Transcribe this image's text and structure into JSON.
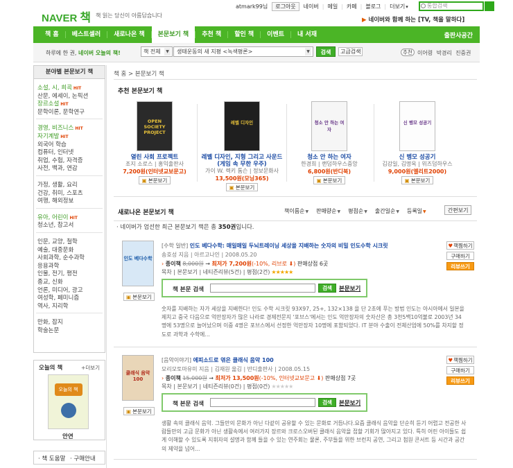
{
  "header": {
    "logo_naver": "NAVER",
    "logo_book": "책",
    "slogan": "책 읽는 당신이 아름답습니다",
    "user": "atmark99님",
    "logout": "로그아웃",
    "nav": [
      "네이버",
      "메일",
      "카페",
      "블로그",
      "더보기"
    ],
    "more_arrow": "▾",
    "search_placeholder": "통합검색",
    "promo": "네이버와 함께 하는 [TV, 책을 말하다]",
    "promo_arrow": "▶"
  },
  "gnav": {
    "items": [
      "책 홈",
      "베스트셀러",
      "새로나온 책",
      "본문보기 책",
      "추천 책",
      "할인 책",
      "이벤트",
      "내 서재"
    ],
    "active_index": 3,
    "right": "출판사공간"
  },
  "subbar": {
    "prefix": "하루에 한 권, ",
    "highlight": "네이버 오늘의 책!",
    "category_value": "책 전체",
    "keyword_value": "생태운동의 새 지평 <녹색평론>",
    "search_btn": "검색",
    "advanced_btn": "고급검색",
    "rec_badge": "추천",
    "rec_names": [
      "이어령",
      "박경리",
      "진중권"
    ]
  },
  "sidebar": {
    "title": "분야별 본문보기 책",
    "groups": [
      [
        {
          "t": "소설, 시, 희곡",
          "g": true,
          "hit": true
        },
        {
          "t": "산문, 에세이, 논픽션"
        },
        {
          "t": "장르소설",
          "g": true,
          "hit": true
        },
        {
          "t": "문학이론, 문학연구"
        }
      ],
      [
        {
          "t": "경영, 비즈니스",
          "g": true,
          "hit": true
        },
        {
          "t": "자기계발",
          "g": true,
          "hit": true
        },
        {
          "t": "외국어 학습"
        },
        {
          "t": "컴퓨터, 인터넷"
        },
        {
          "t": "취업, 수험, 자격증"
        },
        {
          "t": "사전, 백과, 연감"
        }
      ],
      [
        {
          "t": "가정, 생활, 요리"
        },
        {
          "t": "건강, 취미, 스포츠"
        },
        {
          "t": "여행, 해외정보"
        }
      ],
      [
        {
          "t": "유아, 어린이",
          "g": true,
          "hit": true
        },
        {
          "t": "청소년, 참고서"
        }
      ],
      [
        {
          "t": "인문, 교양, 철학"
        },
        {
          "t": "예술, 대중문화"
        },
        {
          "t": "사회과학, 순수과학"
        },
        {
          "t": "응용과학"
        },
        {
          "t": "인물, 전기, 평전"
        },
        {
          "t": "종교, 신화"
        },
        {
          "t": "언론, 미디어, 광고"
        },
        {
          "t": "여성학, 페미니즘"
        },
        {
          "t": "역사, 지리학"
        }
      ],
      [
        {
          "t": "만화, 잡지"
        },
        {
          "t": "학술논문"
        }
      ]
    ],
    "hit_label": "HIT",
    "today_title": "오늘의 책",
    "today_more": "+더보기",
    "today_book": "안연",
    "today_cover_text": "오늘의 책",
    "help1": "책 도움말",
    "help2": "구매안내"
  },
  "main": {
    "breadcrumb": "책 홈 > 본문보기 책",
    "rec_title": "추천 본문보기 책",
    "rec_books": [
      {
        "title": "열린 사회 프로젝트",
        "author": "조지 소로스 | 홍익출판사",
        "price": "7,200원(인터넷교보문고)",
        "btn": "본문보기",
        "cover": "#2a2a2a",
        "cover_text": "OPEN SOCIETY PROJECT"
      },
      {
        "title": "레벨 디자인, 지형 그리고 사운드 (게임 속 무한 우주)",
        "author": "가이 W. 렉키 톰슨 | 정보문화사",
        "price": "13,500원(모닝365)",
        "btn": "본문보기",
        "cover": "#1f1f1f",
        "cover_text": "레벨 디자인"
      },
      {
        "title": "청소 안 하는 여자",
        "author": "한경희 | 랜덤하우스중앙",
        "price": "6,800원(반디북)",
        "btn": "본문보기",
        "cover": "#f6f6f6",
        "cover_text": "청소 안 하는 여자"
      },
      {
        "title": "신 벵모 성공기",
        "author": "김강일, 김명옥 | 위즈덤하우스",
        "price": "9,000원(엘리트2000)",
        "btn": "본문보기",
        "cover": "#fdfdfd",
        "cover_text": "신 벵모 성공기"
      }
    ],
    "new_title": "새로나온 본문보기 책",
    "sorts": [
      "책이름순",
      "판매량순",
      "평점순",
      "출간일순",
      "등록일"
    ],
    "simple_btn": "간편보기",
    "count_text": "네이버가 엄선한 최근 본문보기 책은 총 ",
    "count_num": "350권",
    "count_suffix": "입니다.",
    "items": [
      {
        "category": "[수학 일반]",
        "title": "인도 베다수학: 매일매일 두뇌트레이닝 세상을 지배하는 숫자의 비밀 인도수학 시크릿",
        "meta": "송호성 지음 | 아르고나인 | 2008.05.20",
        "price_label": "종이책",
        "old_price": "8,000원",
        "new_price": "최저가 7,200원",
        "discount": "(-10%, 리브로",
        "stores": "판매상점 6곳",
        "links": "목차 | 본문보기 | 네티즌리뷰(5건) | 평점(2건)",
        "stars": 5,
        "cover_text": "인도 베다수학",
        "actions": [
          "책찜하기",
          "구매하기",
          "리뷰쓰기"
        ],
        "search_label": "책 본문 검색",
        "search_btn": "검색",
        "preview": "본문보기",
        "btn": "본문보기",
        "desc": "숫자를 지배하는 자가 세상을 지배한다! 인도 수학 시크릿 93X97, 25+, 132×138 을 단 2초에 푸는 방법 인도는 아시아에서 일본을 제치고 중국 다음으로 억만장자가 많은 나라로 경제전문지 '포브스'에서는 인도 억만장자의 숫자산은 총 3천5백10억불로 2003년 34명에 53명으로 늘어났으며 이중 4명은 포브스에서 선정한 억만장자 10명에 포함되었다. IT 분야 수출이 전체산업에 50%를 차지할 정도로 과학과 수학에..."
      },
      {
        "category": "[음악이야기]",
        "title": "에피소드로 엮은 클래식 음악 100",
        "meta": "모리모토마유미 지음 | 김재원 옮김 | 반디출판사 | 2008.05.15",
        "price_label": "종이책",
        "old_price": "15,000원",
        "new_price": "최저가 13,500원",
        "discount": "(-10%, 인터넷교보문고",
        "stores": "판매상점 7곳",
        "links": "목차 | 본문보기 | 네티즌리뷰(0건) | 평점(0건)",
        "stars": 0,
        "cover_text": "클래식 음악 100",
        "actions": [
          "책찜하기",
          "구매하기",
          "리뷰쓰기"
        ],
        "search_label": "책 본문 검색",
        "search_btn": "검색",
        "preview": "본문보기",
        "btn": "본문보기",
        "desc": "생활 속의 클래식 음악. 그들만의 문화가 아닌 다같이 공유할 수 있는 문화로 거듭나다.요즘 클래식 음악을 단순히 듣기 어렵고 전공한 사람들만의 고급 문화가 아닌 생활속에서 여러가지 장르와 크로스오버된 클래식 음악을 접할 기회가 많아지고 있다. 특히 어린 아이들도 쉽게 이해할 수 있도록 지휘자의 설명과 함께 들을 수 있는 연주회는 물론, 주부들을 위한 브런치 공연, 그리고 첨원 콘서트 등 시간과 공간의 제약을 넘어..."
      }
    ]
  }
}
